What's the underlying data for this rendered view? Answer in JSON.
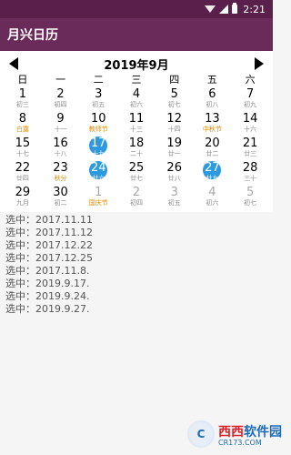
{
  "status": {
    "time": "2:21"
  },
  "app": {
    "title": "月兴日历"
  },
  "calendar": {
    "month_title": "2019年9月",
    "weekdays": [
      "日",
      "一",
      "二",
      "三",
      "四",
      "五",
      "六"
    ],
    "weeks": [
      [
        {
          "d": "1",
          "s": "初三"
        },
        {
          "d": "2",
          "s": "初四"
        },
        {
          "d": "3",
          "s": "初五"
        },
        {
          "d": "4",
          "s": "初六"
        },
        {
          "d": "5",
          "s": "初七"
        },
        {
          "d": "6",
          "s": "初八"
        },
        {
          "d": "7",
          "s": "初九"
        }
      ],
      [
        {
          "d": "8",
          "s": "白露",
          "f": true
        },
        {
          "d": "9",
          "s": "十一"
        },
        {
          "d": "10",
          "s": "教师节",
          "f": true
        },
        {
          "d": "11",
          "s": "十三"
        },
        {
          "d": "12",
          "s": "十四"
        },
        {
          "d": "13",
          "s": "中秋节",
          "f": true
        },
        {
          "d": "14",
          "s": "十六"
        }
      ],
      [
        {
          "d": "15",
          "s": "十七"
        },
        {
          "d": "16",
          "s": "十八"
        },
        {
          "d": "17",
          "s": "十九",
          "sel": true
        },
        {
          "d": "18",
          "s": "二十"
        },
        {
          "d": "19",
          "s": "廿一"
        },
        {
          "d": "20",
          "s": "廿二"
        },
        {
          "d": "21",
          "s": "廿三"
        }
      ],
      [
        {
          "d": "22",
          "s": "廿四"
        },
        {
          "d": "23",
          "s": "秋分",
          "f": true
        },
        {
          "d": "24",
          "s": "廿六",
          "sel": true
        },
        {
          "d": "25",
          "s": "廿七"
        },
        {
          "d": "26",
          "s": "廿八"
        },
        {
          "d": "27",
          "s": "廿九",
          "sel": true
        },
        {
          "d": "28",
          "s": "三十"
        }
      ],
      [
        {
          "d": "29",
          "s": "九月"
        },
        {
          "d": "30",
          "s": "初二"
        },
        {
          "d": "1",
          "s": "国庆节",
          "o": true,
          "f": true
        },
        {
          "d": "2",
          "s": "初四",
          "o": true
        },
        {
          "d": "3",
          "s": "初五",
          "o": true
        },
        {
          "d": "4",
          "s": "初六",
          "o": true
        },
        {
          "d": "5",
          "s": "初七",
          "o": true
        }
      ]
    ]
  },
  "selected_list": [
    "选中：2017.11.11",
    "选中：2017.11.12",
    "选中：2017.12.22",
    "选中：2017.12.25",
    "选中：2017.11.8.",
    "选中：2019.9.17.",
    "选中：2019.9.24.",
    "选中：2019.9.27."
  ],
  "watermark": {
    "brand": "西西",
    "site": "软件园",
    "url": "CR173.COM"
  }
}
